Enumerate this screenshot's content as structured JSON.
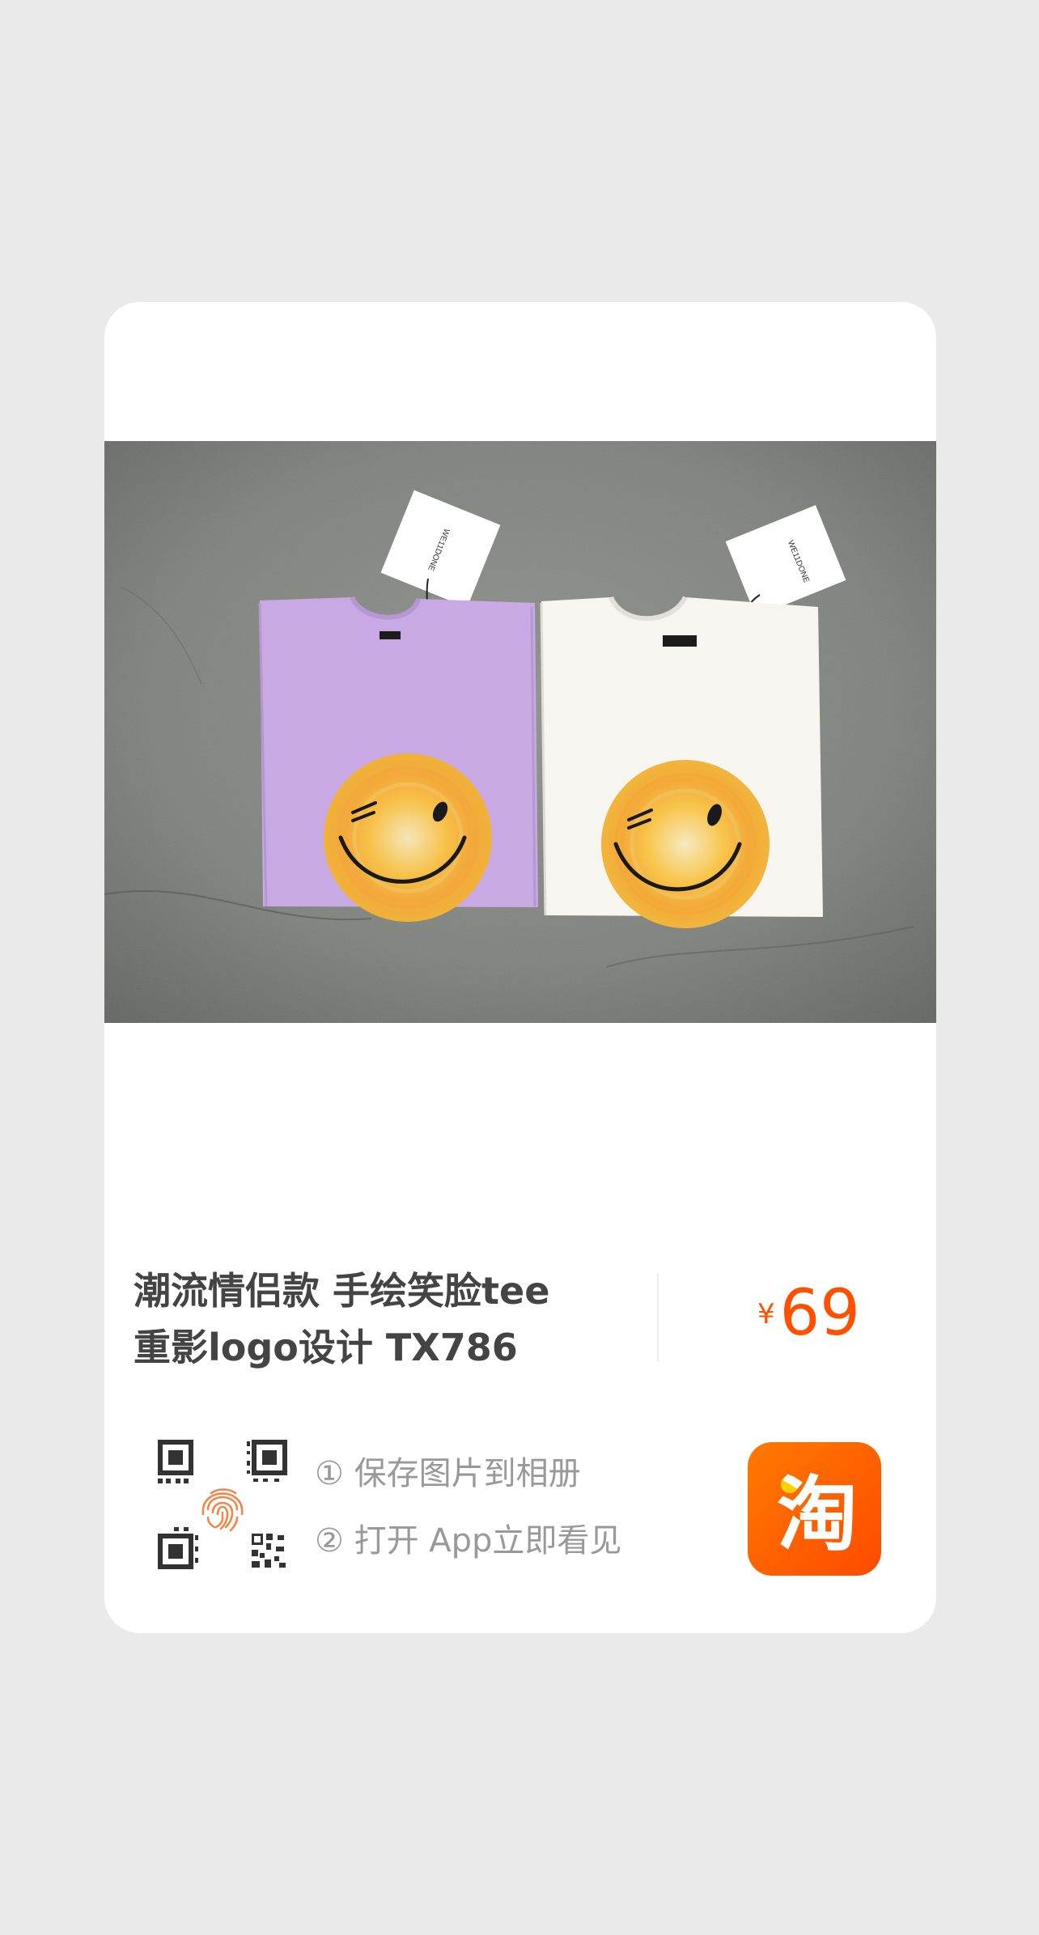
{
  "product": {
    "title_line1": "潮流情侣款 手绘笑脸tee",
    "title_line2": "重影logo设计 TX786",
    "currency": "¥",
    "price": "69",
    "price_color": "#ff5000"
  },
  "instructions": {
    "step1": "① 保存图片到相册",
    "step2": "② 打开 App立即看见"
  },
  "icons": {
    "qr": "qr-fingerprint-icon",
    "app": "taobao-app-icon",
    "app_glyph": "淘"
  },
  "colors": {
    "page_background": "#eaeaea",
    "card_background": "#ffffff",
    "title_text": "#444444",
    "instruction_text": "#999999",
    "brand_orange": "#ff5000"
  }
}
